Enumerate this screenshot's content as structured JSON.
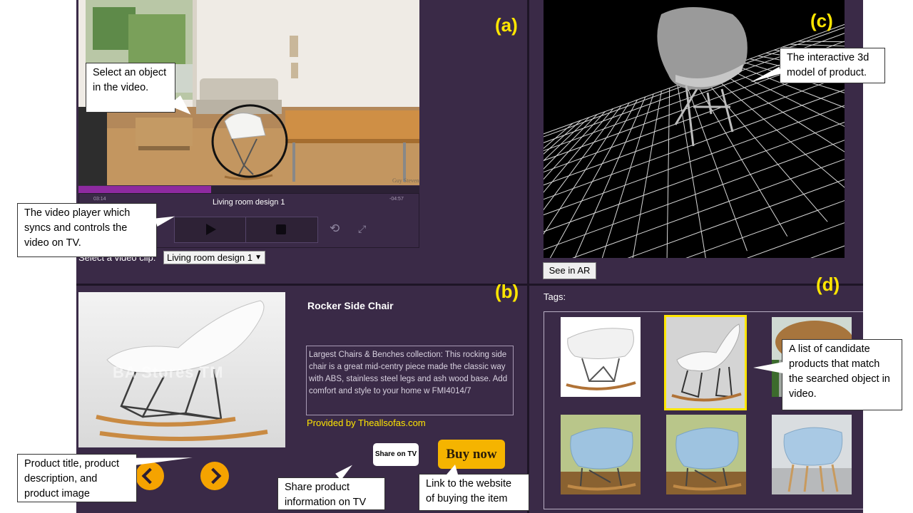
{
  "panel_labels": {
    "a": "(a)",
    "b": "(b)",
    "c": "(c)",
    "d": "(d)"
  },
  "video": {
    "title": "Living room design 1",
    "time_current": "03:14",
    "time_total": "-04:57",
    "progress_fraction": 0.39,
    "select_label": "Select a video clip:",
    "select_value": "Living room design 1"
  },
  "model3d": {
    "see_ar_label": "See in AR"
  },
  "product": {
    "title": "Rocker Side Chair",
    "description": "Largest Chairs & Benches collection: This rocking side chair is a great mid-centry piece made the classic way with ABS, stainless steel legs and ash wood base. Add comfort and style to your home w FMI4014/7",
    "provider": "Provided by Theallsofas.com",
    "image_watermark": "BA Stores TM",
    "share_label": "Share on TV",
    "buy_label": "Buy now"
  },
  "tags": {
    "label": "Tags:"
  },
  "callouts": {
    "select_object": "Select an object in the video.",
    "video_player": "The video player which syncs and controls the video on TV.",
    "model3d": "The interactive 3d model of product.",
    "candidates": "A list of candidate products that match the searched object in video.",
    "product_info": "Product title, product description, and product image",
    "share": "Share product information on TV",
    "buy_link": "Link to the website of buying the item"
  },
  "colors": {
    "accent_yellow": "#ffe600",
    "panel_bg": "#3a2a47",
    "progress": "#8e2aa0",
    "buy_button": "#f5b400",
    "nav_button": "#f5a300"
  }
}
